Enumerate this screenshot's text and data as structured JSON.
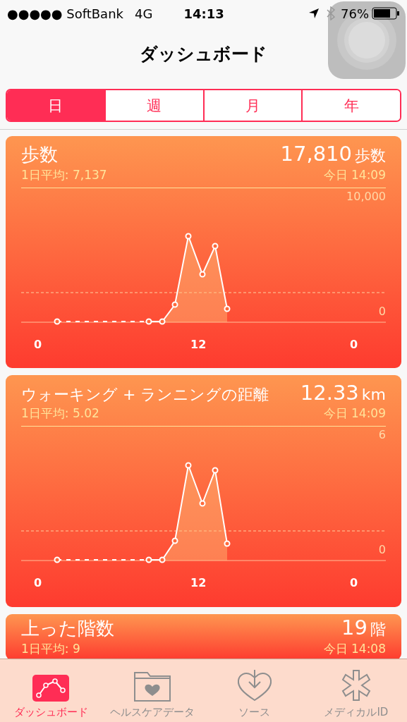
{
  "status_bar": {
    "carrier": "●●●●● SoftBank",
    "network": "4G",
    "time": "14:13",
    "battery": "76%"
  },
  "nav": {
    "title": "ダッシュボード"
  },
  "segments": [
    {
      "label": "日",
      "selected": true
    },
    {
      "label": "週",
      "selected": false
    },
    {
      "label": "月",
      "selected": false
    },
    {
      "label": "年",
      "selected": false
    }
  ],
  "cards": [
    {
      "title": "歩数",
      "value": "17,810",
      "unit": "歩数",
      "average": "1日平均: 7,137",
      "time": "今日 14:09",
      "chart": {
        "top_label": "10,000",
        "zero_label": "0",
        "x_labels": [
          "0",
          "12",
          "0"
        ]
      }
    },
    {
      "title": "ウォーキング + ランニングの距離",
      "value": "12.33",
      "unit": "km",
      "average": "1日平均: 5.02",
      "time": "今日 14:09",
      "chart": {
        "top_label": "6",
        "zero_label": "0",
        "x_labels": [
          "0",
          "12",
          "0"
        ]
      }
    },
    {
      "title": "上った階数",
      "value": "19",
      "unit": "階",
      "average": "1日平均: 9",
      "time": "今日 14:08"
    }
  ],
  "tab_bar": [
    {
      "label": "ダッシュボード",
      "selected": true,
      "kind": "dashboard"
    },
    {
      "label": "ヘルスケアデータ",
      "selected": false,
      "kind": "data"
    },
    {
      "label": "ソース",
      "selected": false,
      "kind": "sources"
    },
    {
      "label": "メディカルID",
      "selected": false,
      "kind": "medical"
    }
  ]
}
